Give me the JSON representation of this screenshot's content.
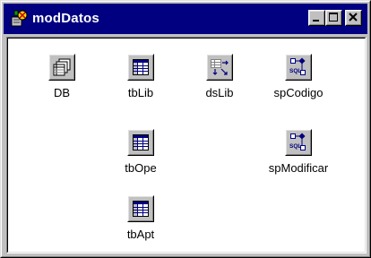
{
  "window": {
    "title": "modDatos",
    "app_icon": "delphi-datamodule-icon",
    "controls": {
      "minimize": "minimize-icon",
      "maximize": "maximize-icon",
      "close": "close-icon"
    }
  },
  "components": [
    {
      "label": "DB",
      "icon": "database-icon"
    },
    {
      "label": "tbLib",
      "icon": "table-icon"
    },
    {
      "label": "dsLib",
      "icon": "datasource-icon"
    },
    {
      "label": "spCodigo",
      "icon": "stored-proc-sql-icon"
    },
    {
      "label": "tbOpe",
      "icon": "table-icon"
    },
    {
      "label": "spModificar",
      "icon": "stored-proc-sql-icon"
    },
    {
      "label": "tbApt",
      "icon": "table-icon"
    }
  ],
  "colors": {
    "titlebar": "#000080",
    "face": "#c0c0c0",
    "client": "#ffffff"
  }
}
